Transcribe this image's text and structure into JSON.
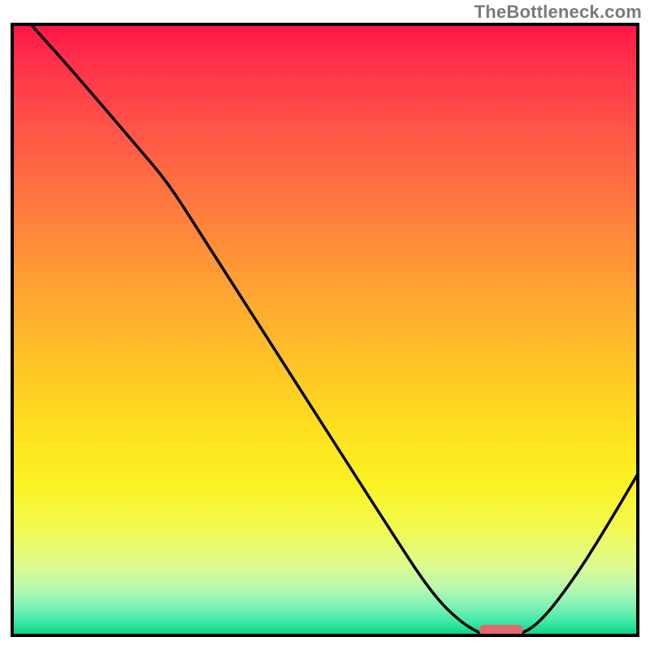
{
  "attribution": "TheBottleneck.com",
  "chart_data": {
    "type": "line",
    "title": "",
    "xlabel": "",
    "ylabel": "",
    "xlim": [
      0,
      100
    ],
    "ylim": [
      0,
      100
    ],
    "grid": false,
    "legend": false,
    "background_gradient": [
      "#ff1346",
      "#ffe01f",
      "#00ce7d"
    ],
    "series": [
      {
        "name": "bottleneck-curve",
        "x": [
          3,
          10,
          20,
          25,
          30,
          40,
          50,
          60,
          67,
          72,
          76,
          80,
          84,
          90,
          96,
          100
        ],
        "y": [
          100,
          92,
          80,
          74,
          66,
          50,
          34,
          18,
          7,
          2,
          0,
          0,
          2,
          10,
          20,
          27
        ]
      }
    ],
    "marker": {
      "name": "optimal-range",
      "shape": "capsule",
      "x_center": 78,
      "y": 0.5,
      "width_pct": 7,
      "color": "#e26a6f"
    },
    "note": "y ≈ bottleneck severity (0 optimal, 100 worst); x ≈ hardware balance axis (unlabeled)"
  }
}
